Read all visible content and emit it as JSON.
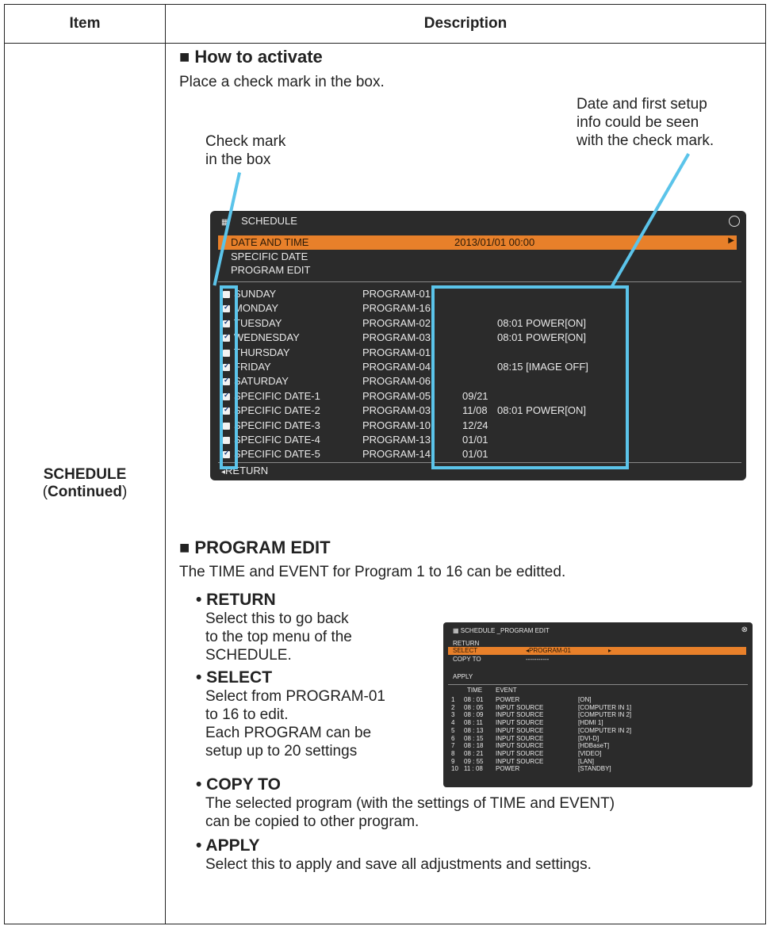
{
  "table": {
    "header_item": "Item",
    "header_description": "Description",
    "item_label": "SCHEDULE",
    "item_sub_open": "(",
    "item_sub": "Continued",
    "item_sub_close": ")"
  },
  "section1": {
    "heading": "■ How to activate",
    "text": "Place a check mark in the box.",
    "callout_left": [
      "Check mark",
      "in the box"
    ],
    "callout_right": [
      "Date and first setup",
      "info could be seen",
      "with the check mark."
    ]
  },
  "schedule_menu": {
    "title": "SCHEDULE",
    "menu_items": [
      "DATE AND TIME",
      "SPECIFIC DATE",
      "PROGRAM EDIT"
    ],
    "date_value": "2013/01/01 00:00",
    "return_label": "RETURN",
    "rows": [
      {
        "name": "SUNDAY",
        "program": "PROGRAM-01",
        "checked": false,
        "date": "",
        "info": ""
      },
      {
        "name": "MONDAY",
        "program": "PROGRAM-16",
        "checked": true,
        "date": "",
        "info": ""
      },
      {
        "name": "TUESDAY",
        "program": "PROGRAM-02",
        "checked": true,
        "date": "",
        "info": "08:01 POWER[ON]"
      },
      {
        "name": "WEDNESDAY",
        "program": "PROGRAM-03",
        "checked": true,
        "date": "",
        "info": "08:01 POWER[ON]"
      },
      {
        "name": "THURSDAY",
        "program": "PROGRAM-01",
        "checked": false,
        "date": "",
        "info": ""
      },
      {
        "name": "FRIDAY",
        "program": "PROGRAM-04",
        "checked": true,
        "date": "",
        "info": "08:15 [IMAGE OFF]"
      },
      {
        "name": "SATURDAY",
        "program": "PROGRAM-06",
        "checked": true,
        "date": "",
        "info": ""
      },
      {
        "name": "SPECIFIC DATE-1",
        "program": "PROGRAM-05",
        "checked": true,
        "date": "09/21",
        "info": ""
      },
      {
        "name": "SPECIFIC DATE-2",
        "program": "PROGRAM-03",
        "checked": true,
        "date": "11/08",
        "info": "08:01 POWER[ON]"
      },
      {
        "name": "SPECIFIC DATE-3",
        "program": "PROGRAM-10",
        "checked": false,
        "date": "12/24",
        "info": ""
      },
      {
        "name": "SPECIFIC DATE-4",
        "program": "PROGRAM-13",
        "checked": false,
        "date": "01/01",
        "info": ""
      },
      {
        "name": "SPECIFIC DATE-5",
        "program": "PROGRAM-14",
        "checked": true,
        "date": "01/01",
        "info": ""
      }
    ]
  },
  "section2": {
    "heading": "■ PROGRAM EDIT",
    "text": "The TIME and EVENT for Program 1 to 16 can be editted.",
    "bullets": [
      {
        "title": "• RETURN",
        "lines": [
          "Select this to go back",
          "to the top menu of the",
          "SCHEDULE."
        ]
      },
      {
        "title": "• SELECT",
        "lines": [
          "Select from PROGRAM-01",
          "to 16 to edit.",
          "Each PROGRAM can be",
          "setup up to 20 settings"
        ]
      },
      {
        "title": "• COPY TO",
        "lines": [
          "The selected program (with the settings of TIME and EVENT)",
          "can be copied to other program."
        ]
      },
      {
        "title": "• APPLY",
        "lines": [
          "Select this to apply and save all adjustments and settings."
        ]
      }
    ]
  },
  "program_menu": {
    "title": "SCHEDULE _PROGRAM EDIT",
    "return": "RETURN",
    "select": "SELECT",
    "select_value": "◂PROGRAM-01",
    "copy_to": "COPY TO",
    "copy_value": "-----------",
    "apply": "APPLY",
    "col_time": "TIME",
    "col_event": "EVENT",
    "rows": [
      {
        "n": "1",
        "time": "08 : 01",
        "event": "POWER",
        "value": "[ON]"
      },
      {
        "n": "2",
        "time": "08 : 05",
        "event": "INPUT SOURCE",
        "value": "[COMPUTER IN 1]"
      },
      {
        "n": "3",
        "time": "08 : 09",
        "event": "INPUT SOURCE",
        "value": "[COMPUTER IN 2]"
      },
      {
        "n": "4",
        "time": "08 : 11",
        "event": "INPUT SOURCE",
        "value": "[HDMI 1]"
      },
      {
        "n": "5",
        "time": "08 : 13",
        "event": "INPUT SOURCE",
        "value": "[COMPUTER IN 2]"
      },
      {
        "n": "6",
        "time": "08 : 15",
        "event": "INPUT SOURCE",
        "value": "[DVI-D]"
      },
      {
        "n": "7",
        "time": "08 : 18",
        "event": "INPUT SOURCE",
        "value": "[HDBaseT]"
      },
      {
        "n": "8",
        "time": "08 : 21",
        "event": "INPUT SOURCE",
        "value": "[VIDEO]"
      },
      {
        "n": "9",
        "time": "09 : 55",
        "event": "INPUT SOURCE",
        "value": "[LAN]"
      },
      {
        "n": "10",
        "time": "11 : 08",
        "event": "POWER",
        "value": "[STANDBY]"
      }
    ]
  }
}
